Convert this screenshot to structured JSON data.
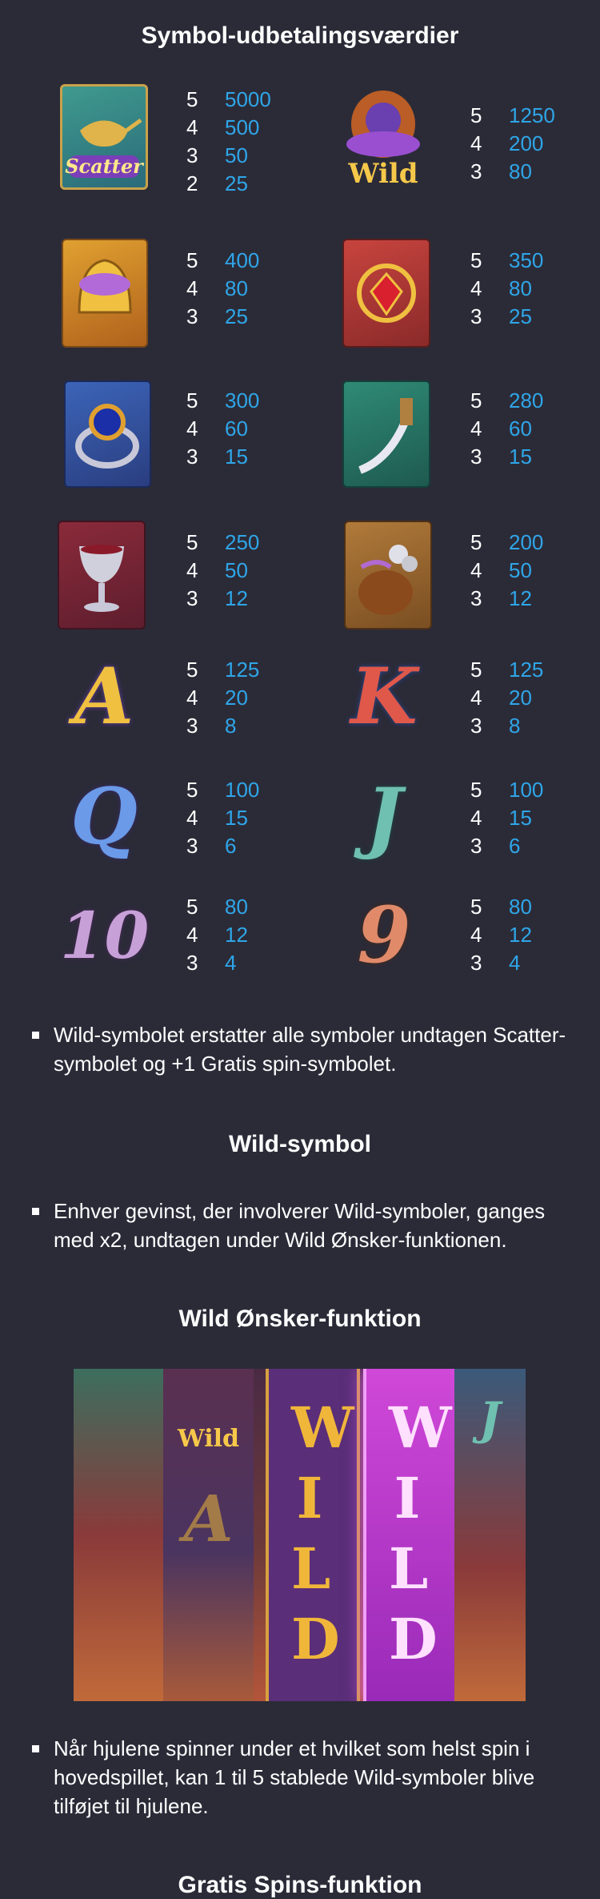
{
  "sections": {
    "paytable_title": "Symbol-udbetalingsværdier",
    "wild_title": "Wild-symbol",
    "wish_title": "Wild Ønsker-funktion",
    "freespins_title": "Gratis Spins-funktion"
  },
  "symbols": {
    "scatter": {
      "label": "Scatter",
      "pays": [
        {
          "n": "5",
          "v": "5000"
        },
        {
          "n": "4",
          "v": "500"
        },
        {
          "n": "3",
          "v": "50"
        },
        {
          "n": "2",
          "v": "25"
        }
      ]
    },
    "wild": {
      "label": "Wild",
      "pays": [
        {
          "n": "5",
          "v": "1250"
        },
        {
          "n": "4",
          "v": "200"
        },
        {
          "n": "3",
          "v": "80"
        }
      ]
    },
    "helmet": {
      "pays": [
        {
          "n": "5",
          "v": "400"
        },
        {
          "n": "4",
          "v": "80"
        },
        {
          "n": "3",
          "v": "25"
        }
      ]
    },
    "amulet": {
      "pays": [
        {
          "n": "5",
          "v": "350"
        },
        {
          "n": "4",
          "v": "80"
        },
        {
          "n": "3",
          "v": "25"
        }
      ]
    },
    "ring": {
      "pays": [
        {
          "n": "5",
          "v": "300"
        },
        {
          "n": "4",
          "v": "60"
        },
        {
          "n": "3",
          "v": "15"
        }
      ]
    },
    "dagger": {
      "pays": [
        {
          "n": "5",
          "v": "280"
        },
        {
          "n": "4",
          "v": "60"
        },
        {
          "n": "3",
          "v": "15"
        }
      ]
    },
    "goblet": {
      "pays": [
        {
          "n": "5",
          "v": "250"
        },
        {
          "n": "4",
          "v": "50"
        },
        {
          "n": "3",
          "v": "12"
        }
      ]
    },
    "coinbag": {
      "pays": [
        {
          "n": "5",
          "v": "200"
        },
        {
          "n": "4",
          "v": "50"
        },
        {
          "n": "3",
          "v": "12"
        }
      ]
    },
    "A": {
      "glyph": "A",
      "pays": [
        {
          "n": "5",
          "v": "125"
        },
        {
          "n": "4",
          "v": "20"
        },
        {
          "n": "3",
          "v": "8"
        }
      ]
    },
    "K": {
      "glyph": "K",
      "pays": [
        {
          "n": "5",
          "v": "125"
        },
        {
          "n": "4",
          "v": "20"
        },
        {
          "n": "3",
          "v": "8"
        }
      ]
    },
    "Q": {
      "glyph": "Q",
      "pays": [
        {
          "n": "5",
          "v": "100"
        },
        {
          "n": "4",
          "v": "15"
        },
        {
          "n": "3",
          "v": "6"
        }
      ]
    },
    "J": {
      "glyph": "J",
      "pays": [
        {
          "n": "5",
          "v": "100"
        },
        {
          "n": "4",
          "v": "15"
        },
        {
          "n": "3",
          "v": "6"
        }
      ]
    },
    "10": {
      "glyph": "10",
      "pays": [
        {
          "n": "5",
          "v": "80"
        },
        {
          "n": "4",
          "v": "12"
        },
        {
          "n": "3",
          "v": "4"
        }
      ]
    },
    "9": {
      "glyph": "9",
      "pays": [
        {
          "n": "5",
          "v": "80"
        },
        {
          "n": "4",
          "v": "12"
        },
        {
          "n": "3",
          "v": "4"
        }
      ]
    }
  },
  "notes": {
    "wild_substitute": "Wild-symbolet erstatter alle symboler undtagen Scatter-symbolet og +1 Gratis spin-symbolet.",
    "wild_multiplier": "Enhver gevinst, der involverer Wild-symboler, ganges med x2, undtagen under Wild Ønsker-funktionen.",
    "wish_feature": "Når hjulene spinner under et hvilket som helst spin i hovedspillet, kan 1 til 5 stablede Wild-symboler blive tilføjet til hjulene."
  },
  "banner": {
    "wild_reel_text": "WILD",
    "wild_badge": "Wild",
    "reel_glyphs": [
      "A",
      "J"
    ]
  },
  "colors": {
    "background": "#2b2b38",
    "payout_value": "#2fa6e8",
    "text": "#ffffff"
  }
}
